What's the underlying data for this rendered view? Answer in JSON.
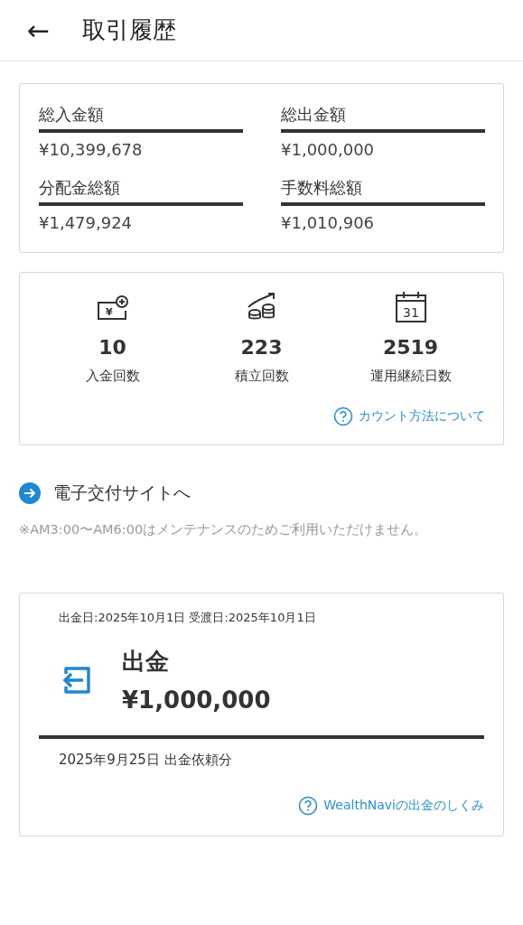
{
  "header": {
    "back": "←",
    "title": "取引履歴"
  },
  "totals": [
    {
      "label": "総入金額",
      "value": "¥10,399,678"
    },
    {
      "label": "総出金額",
      "value": "¥1,000,000"
    },
    {
      "label": "分配金総額",
      "value": "¥1,479,924"
    },
    {
      "label": "手数料総額",
      "value": "¥1,010,906"
    }
  ],
  "stats": {
    "items": [
      {
        "kind": "deposit",
        "icon_text": "¥",
        "value": "10",
        "label": "入金回数"
      },
      {
        "kind": "saving",
        "value": "223",
        "label": "積立回数"
      },
      {
        "kind": "calendar",
        "icon_text": "31",
        "value": "2519",
        "label": "運用継続日数"
      }
    ],
    "help_link": "カウント方法について"
  },
  "site_link": "電子交付サイトへ",
  "maintenance_note": "※AM3:00〜AM6:00はメンテナンスのためご利用いただけません。",
  "transaction": {
    "dates": "出金日:2025年10月1日 受渡日:2025年10月1日",
    "type": "出金",
    "amount": "¥1,000,000",
    "request": "2025年9月25日 出金依頼分",
    "help_link": "WealthNaviの出金のしくみ"
  }
}
